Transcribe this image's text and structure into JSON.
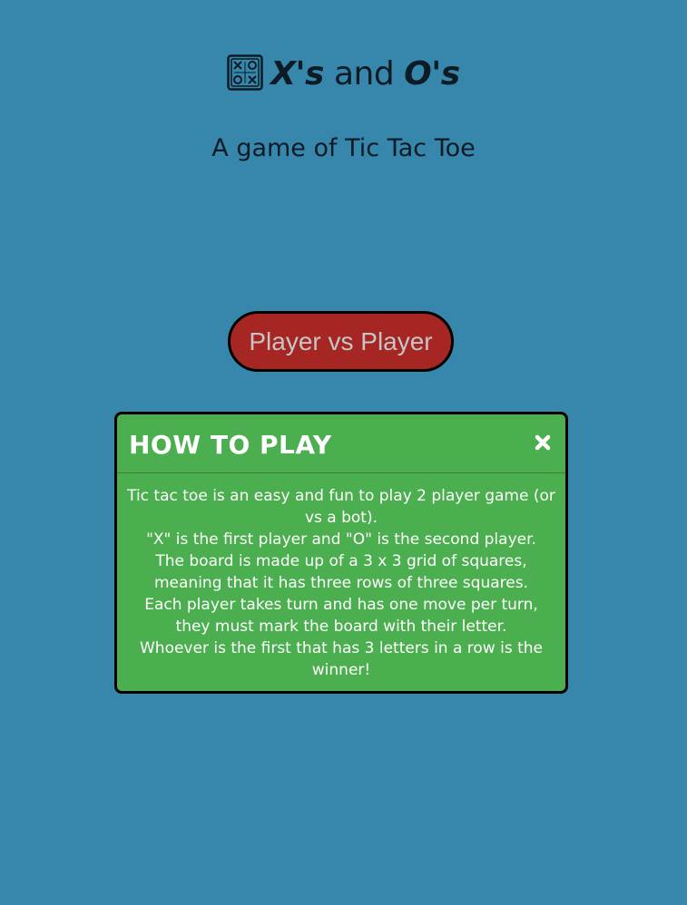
{
  "header": {
    "logo_icon": "tic-tac-toe-board-icon",
    "title_x": "X's",
    "title_and": "and",
    "title_o": "O's",
    "subtitle": "A game of Tic Tac Toe"
  },
  "mode_button": {
    "label": "Player vs Player"
  },
  "how_to_play": {
    "title": "HOW TO PLAY",
    "close_icon": "close-icon",
    "lines": [
      "Tic tac toe is an easy and fun to play 2 player game (or vs a bot).",
      "\"X\" is the first player and \"O\" is the second player.",
      "The board is made up of a 3 x 3 grid of squares, meaning that it has three rows of three squares.",
      "Each player takes turn and has one move per turn, they must mark the board with their letter.",
      "Whoever is the first that has 3 letters in a row is the winner!"
    ]
  },
  "colors": {
    "background": "#3787ad",
    "button_bg": "#a62624",
    "modal_bg": "#4baf4f"
  }
}
